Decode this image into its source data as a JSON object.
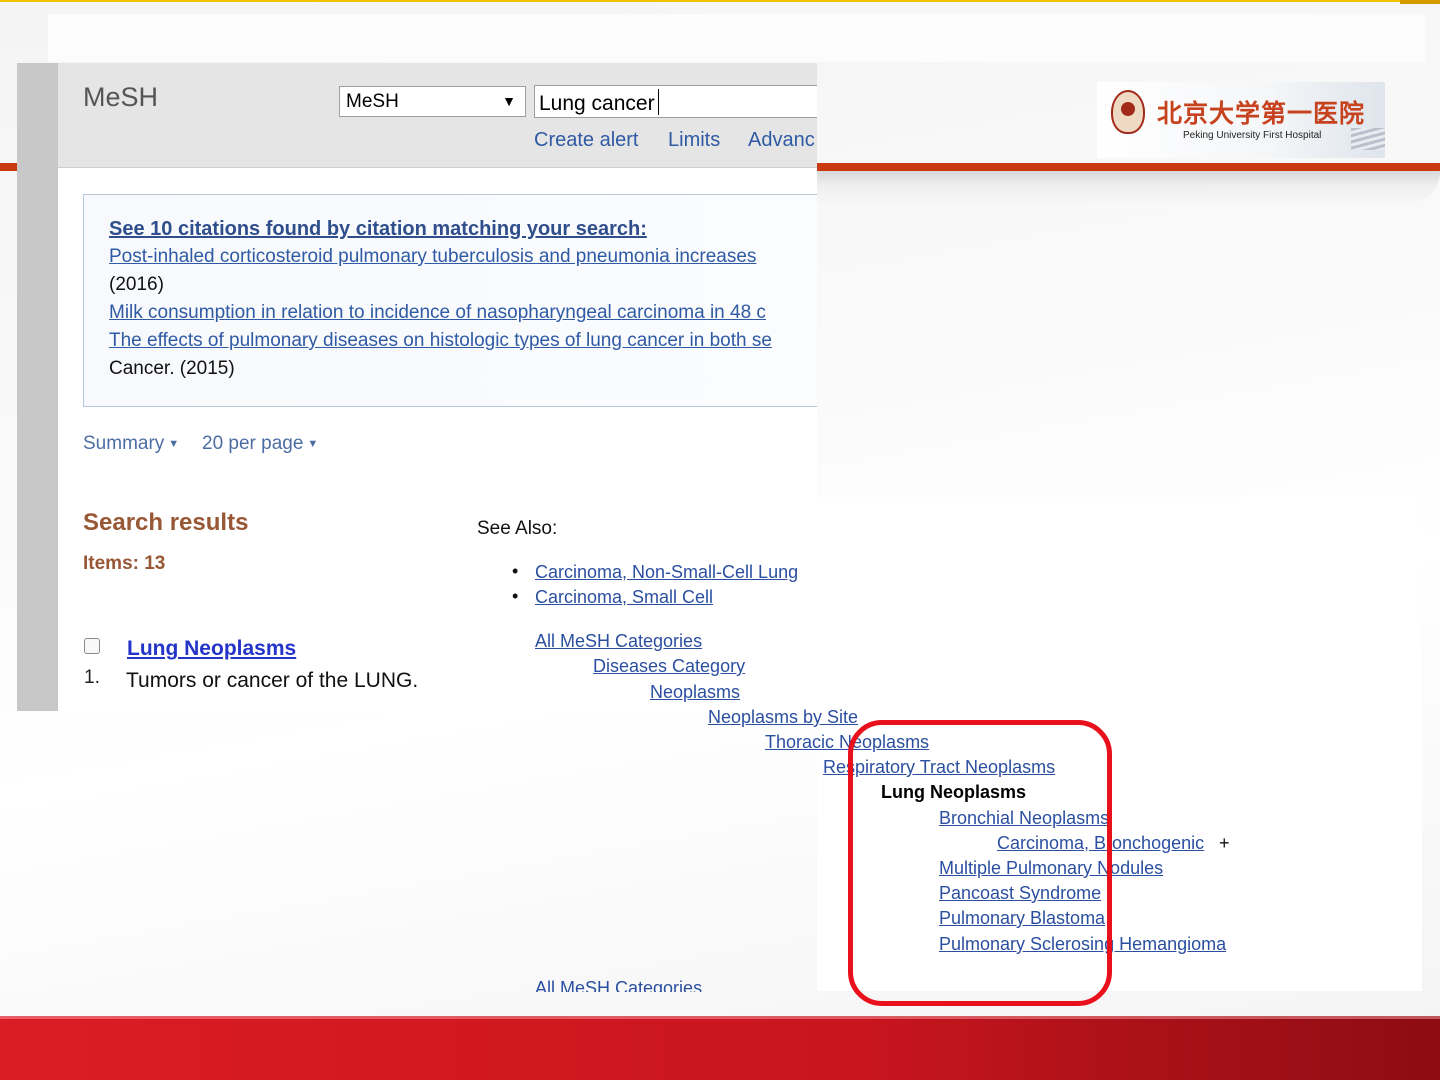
{
  "header": {
    "app_title": "MeSH",
    "database_select": "MeSH",
    "search_value": "Lung cancer",
    "links": [
      "Create alert",
      "Limits",
      "Advanc"
    ]
  },
  "logo": {
    "name_cn": "北京大学第一医院",
    "name_en": "Peking University First Hospital"
  },
  "citations": {
    "heading": "See 10 citations found by citation matching your search:",
    "items": [
      {
        "title": "Post-inhaled corticosteroid pulmonary tuberculosis and pneumonia increases",
        "source": "(2016)"
      },
      {
        "title": "Milk consumption in relation to incidence of nasopharyngeal carcinoma in 48 c",
        "source": ""
      },
      {
        "title": "The effects of pulmonary diseases on histologic types of lung cancer in both se",
        "source": "Cancer. (2015)"
      }
    ]
  },
  "format": {
    "summary": "Summary",
    "per_page": "20 per page"
  },
  "results": {
    "title": "Search results",
    "count": "Items: 13",
    "items": [
      {
        "number": "1.",
        "title": "Lung Neoplasms",
        "description": "Tumors or cancer of the LUNG."
      }
    ]
  },
  "see_also": {
    "label": "See Also:",
    "items": [
      "Carcinoma, Non-Small-Cell Lung",
      "Carcinoma, Small Cell"
    ]
  },
  "tree": {
    "nodes": [
      "All MeSH Categories",
      "Diseases Category",
      "Neoplasms",
      "Neoplasms by Site",
      "Thoracic Neoplasms",
      "Respiratory Tract Neoplasms",
      "Lung Neoplasms",
      "Bronchial Neoplasms",
      "Carcinoma, Bronchogenic",
      "Multiple Pulmonary Nodules",
      "Pancoast Syndrome",
      "Pulmonary Blastoma",
      "Pulmonary Sclerosing Hemangioma",
      "All MeSH Categories"
    ],
    "expand_marker": "+"
  },
  "colors": {
    "highlight": "#e8101a",
    "accent_orange": "#c93a12",
    "bottom_band": "#dc1c24",
    "link": "#2b4fa0"
  }
}
